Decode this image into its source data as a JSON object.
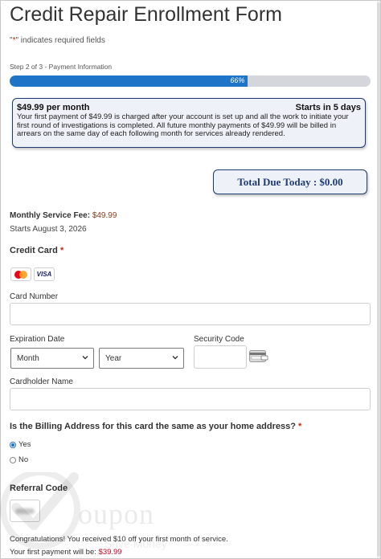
{
  "form": {
    "title": "Credit Repair Enrollment Form",
    "required_note_quote": "\"",
    "required_note_star": "*",
    "required_note_rest": "\" indicates required fields"
  },
  "progress": {
    "step_text": "Step 2 of 3 - Payment Information",
    "percent_label": "66%",
    "percent": 66
  },
  "plan": {
    "price_title": "$49.99 per month",
    "starts_in": "Starts in 5 days",
    "description": "Your first payment of $49.99  is charged after your account is set up and all the work to initiate your first round of investigations is completed. All future monthly payments of $49.99  will be billed in arrears on the same day of each following month for services already rendered."
  },
  "total": {
    "label": "Total Due Today : $0.00"
  },
  "fee": {
    "label": "Monthly Service Fee: ",
    "amount": "$49.99",
    "starts": "Starts August 3, 2026"
  },
  "credit_card": {
    "section_label": "Credit Card",
    "required_star": "*",
    "card_icons": [
      "mastercard-icon",
      "visa-icon"
    ],
    "visa_text": "VISA",
    "card_number_label": "Card Number",
    "card_number_value": "",
    "expiration_label": "Expiration Date",
    "month_selected": "Month",
    "year_selected": "Year",
    "security_code_label": "Security Code",
    "security_code_value": "",
    "cardholder_label": "Cardholder Name",
    "cardholder_value": ""
  },
  "billing": {
    "question": "Is the Billing Address for this card the same as your home address?",
    "required_star": "*",
    "options": [
      {
        "label": "Yes",
        "selected": true
      },
      {
        "label": "No",
        "selected": false
      }
    ]
  },
  "referral": {
    "label": "Referral Code"
  },
  "promo": {
    "congrats": "Congratulations! You received $10 off your first month of service.",
    "first_payment_label": "Your first payment will be: ",
    "first_payment_amount": "$39.99"
  },
  "watermark": {
    "brand_text": "oupon",
    "tagline": "Save Money"
  },
  "colors": {
    "accent": "#1e74c7",
    "navy": "#1f3b73",
    "required": "#c02b0a",
    "price_red": "#d0021b"
  }
}
